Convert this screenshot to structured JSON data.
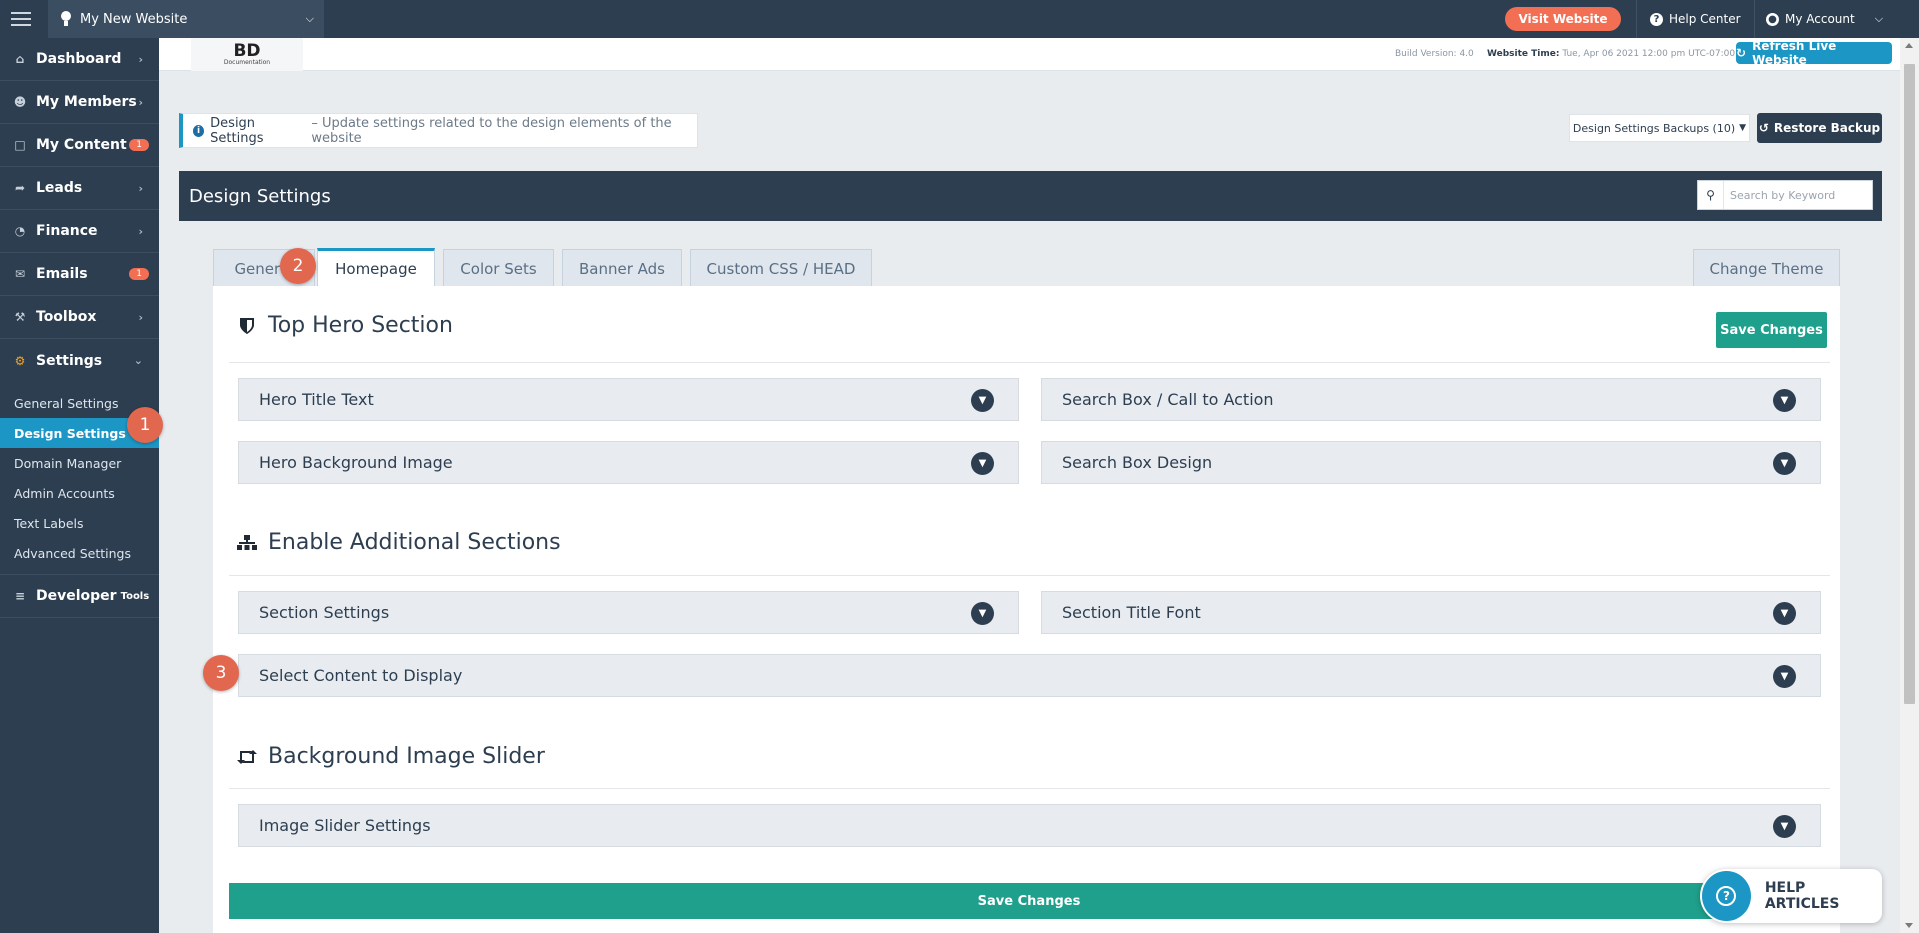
{
  "topbar": {
    "site_name": "My New Website",
    "visit_label": "Visit Website",
    "help_center": "Help Center",
    "my_account": "My Account"
  },
  "header": {
    "logo_text": "BD",
    "logo_sub": "Documentation",
    "build_version": "Build Version: 4.0",
    "website_time_label": "Website Time:",
    "website_time_value": "Tue, Apr 06 2021 12:00 pm UTC-07:00",
    "refresh_label": "Refresh Live Website"
  },
  "sidebar": {
    "items": [
      {
        "label": "Dashboard",
        "icon": "home-icon"
      },
      {
        "label": "My Members",
        "icon": "users-icon"
      },
      {
        "label": "My Content",
        "icon": "folder-icon",
        "badge": "1"
      },
      {
        "label": "Leads",
        "icon": "share-icon"
      },
      {
        "label": "Finance",
        "icon": "pie-chart-icon"
      },
      {
        "label": "Emails",
        "icon": "inbox-icon",
        "badge": "1"
      },
      {
        "label": "Toolbox",
        "icon": "wrench-icon"
      },
      {
        "label": "Settings",
        "icon": "gear-icon"
      }
    ],
    "settings_sub": [
      "General Settings",
      "Design Settings",
      "Domain Manager",
      "Admin Accounts",
      "Text Labels",
      "Advanced Settings"
    ],
    "developer": "Developer",
    "developer_small": "Tools"
  },
  "steps": [
    "1",
    "2",
    "3"
  ],
  "notice": {
    "title": "Design Settings",
    "desc": "– Update settings related to the design elements of the website"
  },
  "backups": {
    "dropdown": "Design Settings Backups (10)",
    "restore": "Restore Backup"
  },
  "panel": {
    "title": "Design Settings",
    "search_placeholder": "Search by Keyword"
  },
  "tabs": [
    "General",
    "Homepage",
    "Color Sets",
    "Banner Ads",
    "Custom CSS / HEAD"
  ],
  "change_theme": "Change Theme",
  "sections": {
    "hero": {
      "title": "Top Hero Section",
      "items": [
        "Hero Title Text",
        "Search Box / Call to Action",
        "Hero Background Image",
        "Search Box Design"
      ]
    },
    "additional": {
      "title": "Enable Additional Sections",
      "items": [
        "Section Settings",
        "Section Title Font",
        "Select Content to Display"
      ]
    },
    "slider": {
      "title": "Background Image Slider",
      "items": [
        "Image Slider Settings"
      ]
    }
  },
  "save_label": "Save Changes",
  "help_articles": "HELP ARTICLES"
}
